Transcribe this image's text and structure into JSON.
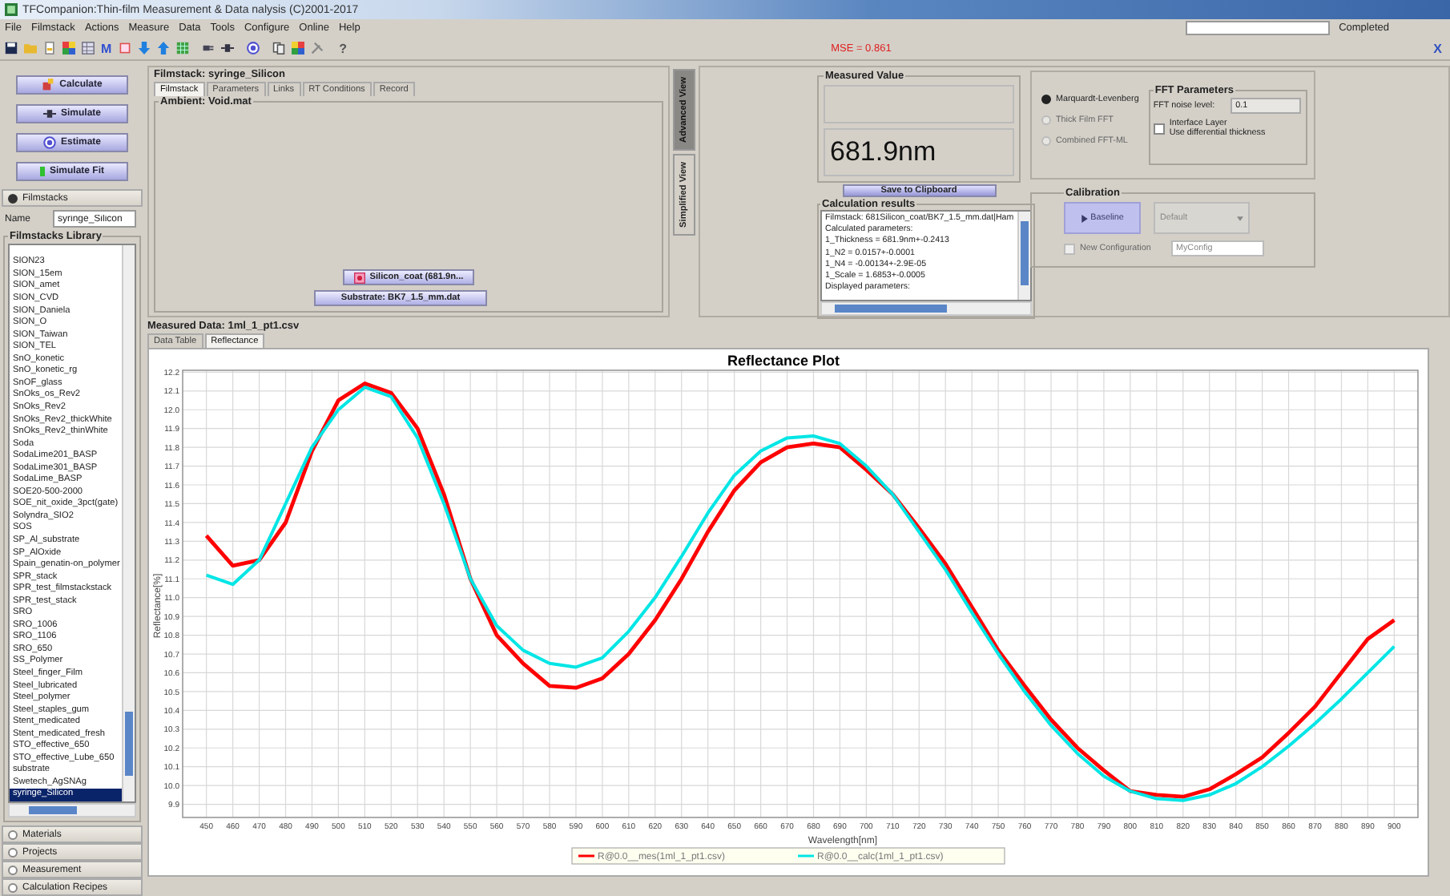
{
  "window": {
    "title": "TFCompanion:Thin-film Measurement & Data nalysis (C)2001-2017"
  },
  "menu": [
    "File",
    "Filmstack",
    "Actions",
    "Measure",
    "Data",
    "Tools",
    "Configure",
    "Online",
    "Help"
  ],
  "progress": {
    "label": "Completed",
    "level": 0
  },
  "toolbar": {
    "letter_button": "M",
    "help_button": "?"
  },
  "mse": "MSE = 0.861",
  "close_button": "X",
  "actions": [
    {
      "label": "Calculate",
      "kind": "calculate"
    },
    {
      "label": "Simulate",
      "kind": "simulate"
    },
    {
      "label": "Estimate",
      "kind": "estimate"
    },
    {
      "label": "Simulate Fit",
      "kind": "fit"
    }
  ],
  "sections": [
    {
      "label": "Filmstacks",
      "expanded": true
    },
    {
      "label": "Materials",
      "expanded": false
    },
    {
      "label": "Projects",
      "expanded": false
    },
    {
      "label": "Measurement",
      "expanded": false
    },
    {
      "label": "Calculation Recipes",
      "expanded": false
    }
  ],
  "filmstacks": {
    "name_label": "Name",
    "name_value": "syringe_Silicon",
    "library_title": "Filmstacks Library",
    "items": [
      {
        "label": "SION23",
        "selected": false
      },
      {
        "label": "SION_15em",
        "selected": false
      },
      {
        "label": "SION_amet",
        "selected": false
      },
      {
        "label": "SION_CVD",
        "selected": false
      },
      {
        "label": "SION_Daniela",
        "selected": false
      },
      {
        "label": "SION_O",
        "selected": false
      },
      {
        "label": "SION_Taiwan",
        "selected": false
      },
      {
        "label": "SION_TEL",
        "selected": false
      },
      {
        "label": "SnO_konetic",
        "selected": false
      },
      {
        "label": "SnO_konetic_rg",
        "selected": false
      },
      {
        "label": "SnOF_glass",
        "selected": false
      },
      {
        "label": "SnOks_os_Rev2",
        "selected": false
      },
      {
        "label": "SnOks_Rev2",
        "selected": false
      },
      {
        "label": "SnOks_Rev2_thickWhite",
        "selected": false
      },
      {
        "label": "SnOks_Rev2_thinWhite",
        "selected": false
      },
      {
        "label": "Soda",
        "selected": false
      },
      {
        "label": "SodaLime201_BASP",
        "selected": false
      },
      {
        "label": "SodaLime301_BASP",
        "selected": false
      },
      {
        "label": "SodaLime_BASP",
        "selected": false
      },
      {
        "label": "SOE20-500-2000",
        "selected": false
      },
      {
        "label": "SOE_nit_oxide_3pct(gate)",
        "selected": false
      },
      {
        "label": "Solyndra_SIO2",
        "selected": false
      },
      {
        "label": "SOS",
        "selected": false
      },
      {
        "label": "SP_Al_substrate",
        "selected": false
      },
      {
        "label": "SP_AlOxide",
        "selected": false
      },
      {
        "label": "Spain_genatin-on_polymer",
        "selected": false
      },
      {
        "label": "SPR_stack",
        "selected": false
      },
      {
        "label": "SPR_test_filmstackstack",
        "selected": false
      },
      {
        "label": "SPR_test_stack",
        "selected": false
      },
      {
        "label": "SRO",
        "selected": false
      },
      {
        "label": "SRO_1006",
        "selected": false
      },
      {
        "label": "SRO_1106",
        "selected": false
      },
      {
        "label": "SRO_650",
        "selected": false
      },
      {
        "label": "SS_Polymer",
        "selected": false
      },
      {
        "label": "Steel_finger_Film",
        "selected": false
      },
      {
        "label": "Steel_lubricated",
        "selected": false
      },
      {
        "label": "Steel_polymer",
        "selected": false
      },
      {
        "label": "Steel_staples_gum",
        "selected": false
      },
      {
        "label": "Stent_medicated",
        "selected": false
      },
      {
        "label": "Stent_medicated_fresh",
        "selected": false
      },
      {
        "label": "STO_effective_650",
        "selected": false
      },
      {
        "label": "STO_effective_Lube_650",
        "selected": false
      },
      {
        "label": "substrate",
        "selected": false
      },
      {
        "label": "Swetech_AgSNAg",
        "selected": false
      },
      {
        "label": "syringe_Silicon",
        "selected": true
      }
    ]
  },
  "filmstack_panel": {
    "title": "Filmstack: syringe_Silicon",
    "tabs": [
      {
        "label": "Filmstack",
        "selected": true
      },
      {
        "label": "Parameters",
        "selected": false
      },
      {
        "label": "Links",
        "selected": false
      },
      {
        "label": "RT Conditions",
        "selected": false
      },
      {
        "label": "Record",
        "selected": false
      }
    ],
    "ambient": "Ambient: Void.mat",
    "layer_button": "Silicon_coat (681.9n...",
    "substrate_button": "Substrate: BK7_1.5_mm.dat"
  },
  "view_tabs": [
    {
      "label": "Advanced View",
      "selected": true
    },
    {
      "label": "Simplified View",
      "selected": false
    }
  ],
  "measured_value": {
    "title": "Measured Value",
    "value": "681.9nm"
  },
  "save_button": "Save to Clipboard",
  "calculation_results": {
    "title": "Calculation results",
    "lines": [
      "Filmstack: 681Silicon_coat/BK7_1.5_mm.dat|Ham",
      "Calculated parameters:",
      "1_Thickness = 681.9nm+-0.2413",
      "1_N2 = 0.0157+-0.0001",
      "1_N4 = -0.00134+-2.9E-05",
      "1_Scale = 1.6853+-0.0005",
      "Displayed parameters:"
    ]
  },
  "algorithm": {
    "options": [
      {
        "label": "Marquardt-Levenberg",
        "selected": true
      },
      {
        "label": "Thick Film FFT",
        "selected": false
      },
      {
        "label": "Combined FFT-ML",
        "selected": false
      }
    ],
    "fft": {
      "title": "FFT Parameters",
      "noise_label": "FFT noise level:",
      "noise_value": "0.1",
      "interface_checkbox": {
        "lines": [
          "Interface Layer",
          "Use differential thickness"
        ],
        "checked": false
      }
    }
  },
  "calibration": {
    "title": "Calibration",
    "baseline_button": {
      "label": "Baseline",
      "disabled": true
    },
    "config_select": {
      "value": "Default",
      "disabled": true
    },
    "new_config": {
      "label": "New Configuration",
      "checked": false,
      "disabled": true
    },
    "config_field": "MyConfig"
  },
  "measured_data": {
    "title": "Measured Data: 1ml_1_pt1.csv",
    "tabs": [
      {
        "label": "Data Table",
        "selected": false
      },
      {
        "label": "Reflectance",
        "selected": true
      }
    ],
    "chart_data": {
      "type": "line",
      "title": "Reflectance Plot",
      "xlabel": "Wavelength[nm]",
      "ylabel": "Reflectance[%]",
      "x": [
        450,
        460,
        470,
        480,
        490,
        500,
        510,
        520,
        530,
        540,
        550,
        560,
        570,
        580,
        590,
        600,
        610,
        620,
        630,
        640,
        650,
        660,
        670,
        680,
        690,
        700,
        710,
        720,
        730,
        740,
        750,
        760,
        770,
        780,
        790,
        800,
        810,
        820,
        830,
        840,
        850,
        860,
        870,
        880,
        890,
        900
      ],
      "series": [
        {
          "name": "R@0.0__mes(1ml_1_pt1.csv)",
          "color": "#ff0000",
          "values": [
            11.33,
            11.17,
            11.2,
            11.4,
            11.78,
            12.05,
            12.14,
            12.09,
            11.9,
            11.55,
            11.1,
            10.8,
            10.65,
            10.53,
            10.52,
            10.57,
            10.7,
            10.88,
            11.1,
            11.35,
            11.57,
            11.72,
            11.8,
            11.82,
            11.8,
            11.68,
            11.55,
            11.37,
            11.18,
            10.95,
            10.72,
            10.53,
            10.35,
            10.2,
            10.08,
            9.97,
            9.95,
            9.94,
            9.98,
            10.06,
            10.15,
            10.28,
            10.42,
            10.6,
            10.78,
            10.88
          ]
        },
        {
          "name": "R@0.0__calc(1ml_1_pt1.csv)",
          "color": "#00e5e5",
          "values": [
            11.12,
            11.07,
            11.2,
            11.5,
            11.8,
            12.0,
            12.12,
            12.07,
            11.85,
            11.5,
            11.1,
            10.85,
            10.72,
            10.65,
            10.63,
            10.68,
            10.82,
            11.0,
            11.22,
            11.45,
            11.65,
            11.78,
            11.85,
            11.86,
            11.82,
            11.7,
            11.55,
            11.35,
            11.15,
            10.92,
            10.7,
            10.5,
            10.32,
            10.17,
            10.05,
            9.97,
            9.93,
            9.92,
            9.95,
            10.01,
            10.1,
            10.21,
            10.33,
            10.46,
            10.6,
            10.74
          ]
        }
      ],
      "xlim": [
        441,
        909
      ],
      "ylim": [
        9.83,
        12.21
      ],
      "xticks": [
        450,
        460,
        470,
        480,
        490,
        500,
        510,
        520,
        530,
        540,
        550,
        560,
        570,
        580,
        590,
        600,
        610,
        620,
        630,
        640,
        650,
        660,
        670,
        680,
        690,
        700,
        710,
        720,
        730,
        740,
        750,
        760,
        770,
        780,
        790,
        800,
        810,
        820,
        830,
        840,
        850,
        860,
        870,
        880,
        890,
        900
      ],
      "yticks": [
        9.9,
        {
          "value": 10,
          "label": "10.0"
        },
        10.1,
        10.2,
        10.3,
        10.4,
        10.5,
        10.6,
        10.7,
        10.8,
        10.9,
        {
          "value": 11,
          "label": "11.0"
        },
        11.1,
        11.2,
        11.3,
        11.4,
        11.5,
        11.6,
        11.7,
        11.8,
        11.9,
        {
          "value": 12,
          "label": "12.0"
        },
        12.1,
        12.2
      ],
      "grid": true,
      "legend": "bottom"
    }
  }
}
